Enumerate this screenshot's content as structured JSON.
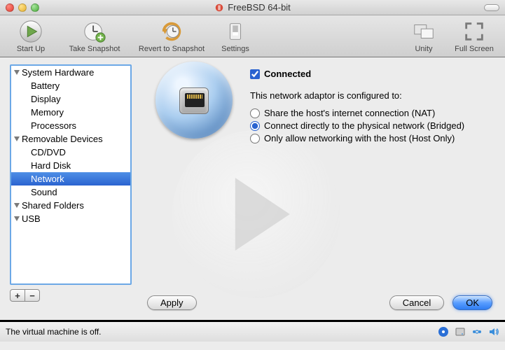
{
  "window": {
    "title": "FreeBSD 64-bit"
  },
  "toolbar": {
    "startup": "Start Up",
    "snapshot": "Take Snapshot",
    "revert": "Revert to Snapshot",
    "settings": "Settings",
    "unity": "Unity",
    "fullscreen": "Full Screen"
  },
  "sidebar": {
    "groups": [
      {
        "label": "System Hardware",
        "items": [
          "Battery",
          "Display",
          "Memory",
          "Processors"
        ]
      },
      {
        "label": "Removable Devices",
        "items": [
          "CD/DVD",
          "Hard Disk",
          "Network",
          "Sound"
        ]
      },
      {
        "label": "Shared Folders",
        "items": []
      },
      {
        "label": "USB",
        "items": []
      }
    ],
    "selected": "Network",
    "add": "+",
    "remove": "−"
  },
  "panel": {
    "connected_label": "Connected",
    "connected_checked": true,
    "config_text": "This network adaptor is configured to:",
    "options": [
      "Share the host's internet connection (NAT)",
      "Connect directly to the physical network (Bridged)",
      "Only allow networking with the host (Host Only)"
    ],
    "selected_option": 1
  },
  "buttons": {
    "apply": "Apply",
    "cancel": "Cancel",
    "ok": "OK"
  },
  "status": {
    "text": "The virtual machine is off."
  }
}
